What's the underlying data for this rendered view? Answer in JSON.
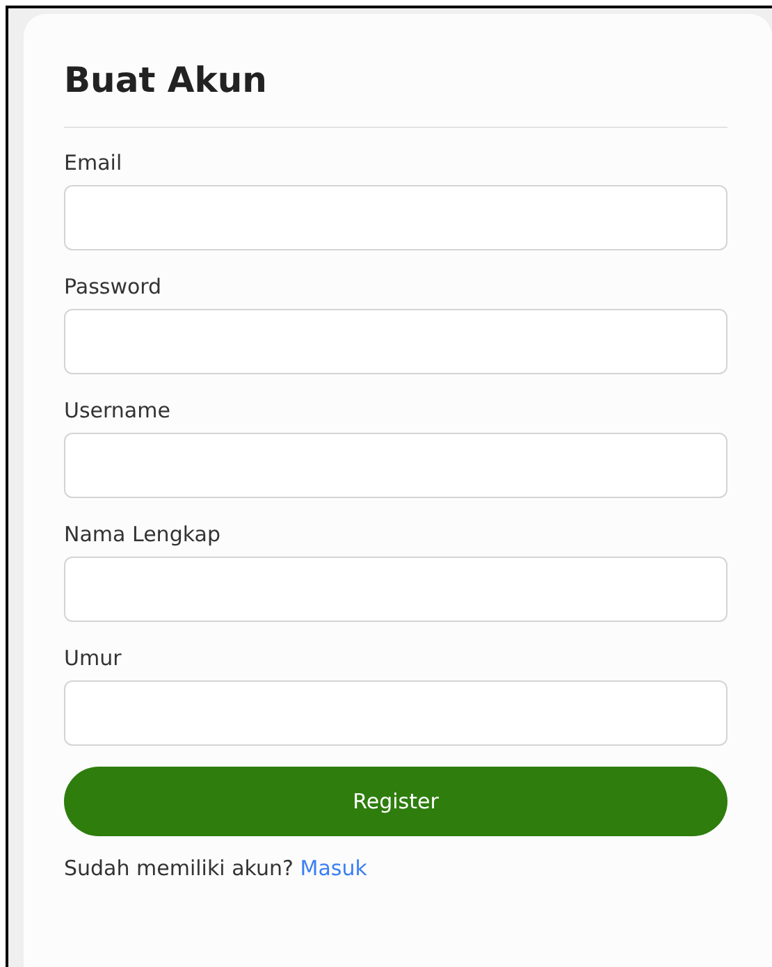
{
  "title": "Buat Akun",
  "fields": [
    {
      "label": "Email"
    },
    {
      "label": "Password"
    },
    {
      "label": "Username"
    },
    {
      "label": "Nama Lengkap"
    },
    {
      "label": "Umur"
    }
  ],
  "submit": "Register",
  "footer": {
    "text": "Sudah memiliki akun?",
    "link": "Masuk"
  }
}
